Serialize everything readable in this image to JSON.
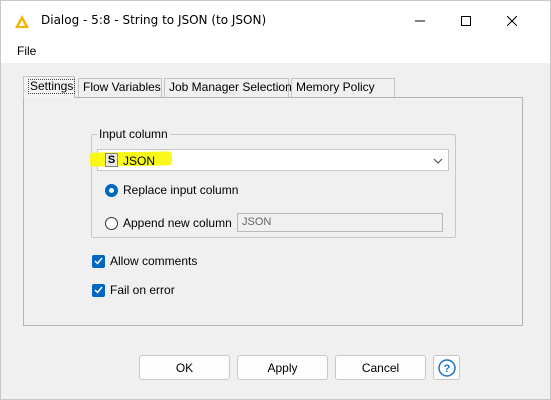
{
  "window": {
    "title": "Dialog - 5:8 - String to JSON (to JSON)"
  },
  "menu": {
    "file": "File"
  },
  "tabs": [
    {
      "label": "Settings",
      "active": true
    },
    {
      "label": "Flow Variables",
      "active": false
    },
    {
      "label": "Job Manager Selection",
      "active": false
    },
    {
      "label": "Memory Policy",
      "active": false
    }
  ],
  "settings": {
    "input_column_legend": "Input column",
    "input_column": {
      "type_badge": "S",
      "value": "JSON"
    },
    "replace_label": "Replace input column",
    "replace_selected": true,
    "append_label": "Append new column",
    "append_value": "JSON",
    "allow_comments_label": "Allow comments",
    "allow_comments_checked": true,
    "fail_on_error_label": "Fail on error",
    "fail_on_error_checked": true
  },
  "buttons": {
    "ok": "OK",
    "apply": "Apply",
    "cancel": "Cancel",
    "help": "?"
  },
  "colors": {
    "accent": "#0067c0",
    "highlight": "#f8f800",
    "app_icon": "#f2b600"
  }
}
